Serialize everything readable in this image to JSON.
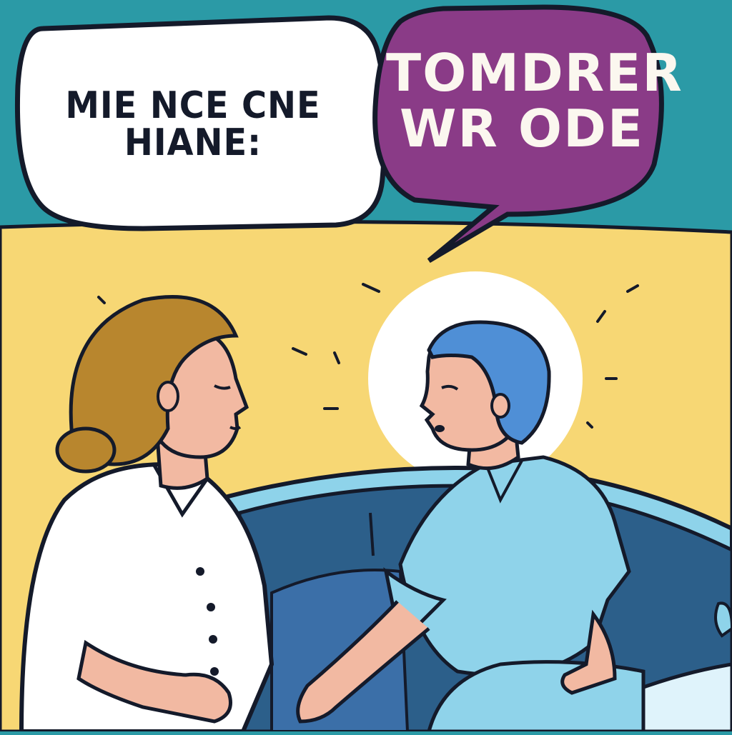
{
  "left_bubble": {
    "line1": "MIE NCE CNE",
    "line2": "HIANE:"
  },
  "right_bubble": {
    "line1": "TOMDRER",
    "line2": "WR ODE"
  },
  "colors": {
    "sky": "#2b9aa6",
    "wall": "#f7d774",
    "bubble_left": "#ffffff",
    "bubble_right": "#8a3b87",
    "outline": "#141a2a",
    "car_body": "#8ed3ea",
    "car_interior": "#2c5f8a",
    "seat": "#3b6fa8",
    "nurse_uniform": "#ffffff",
    "patient_gown": "#8fd3ea",
    "patient_hair": "#4f8fd6",
    "nurse_hair": "#b8862e",
    "skin": "#f2b9a2"
  }
}
